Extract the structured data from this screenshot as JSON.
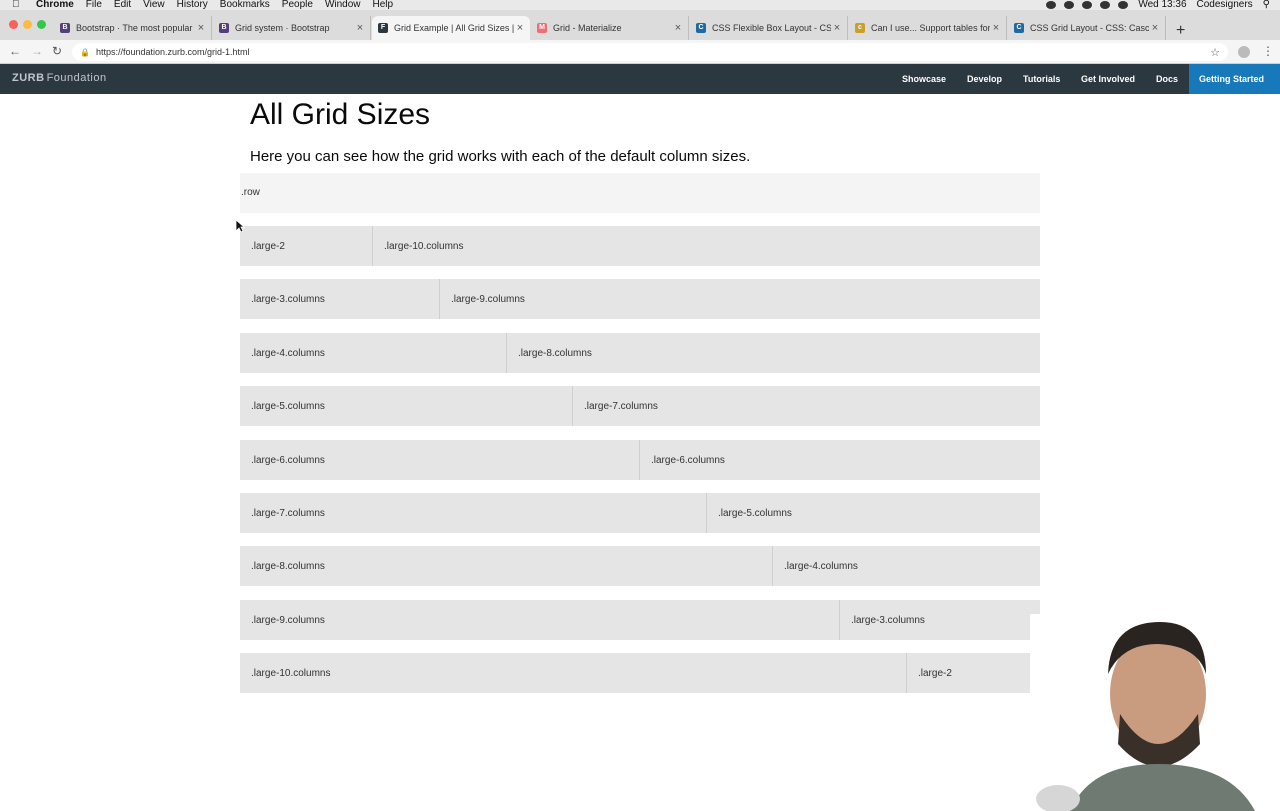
{
  "menubar": {
    "app": "Chrome",
    "items": [
      "File",
      "Edit",
      "View",
      "History",
      "Bookmarks",
      "People",
      "Window",
      "Help"
    ],
    "clock": "Wed 13:36",
    "user": "Codesigners"
  },
  "tabs": [
    {
      "title": "Bootstrap · The most popular H",
      "favicon": "B",
      "color": "#563d7c"
    },
    {
      "title": "Grid system · Bootstrap",
      "favicon": "B",
      "color": "#563d7c"
    },
    {
      "title": "Grid Example | All Grid Sizes | F",
      "favicon": "F",
      "color": "#2c3840"
    },
    {
      "title": "Grid - Materialize",
      "favicon": "M",
      "color": "#ee6e73"
    },
    {
      "title": "CSS Flexible Box Layout - CSS",
      "favicon": "C",
      "color": "#1f6aa5"
    },
    {
      "title": "Can I use... Support tables for",
      "favicon": "c",
      "color": "#c8a02c"
    },
    {
      "title": "CSS Grid Layout - CSS: Cascad",
      "favicon": "C",
      "color": "#1f6aa5"
    }
  ],
  "address": {
    "url": "https://foundation.zurb.com/grid-1.html"
  },
  "topbar": {
    "logo_zurb": "ZURB",
    "logo_foundation": "Foundation",
    "nav": [
      "Showcase",
      "Develop",
      "Tutorials",
      "Get Involved",
      "Docs"
    ],
    "cta": "Getting Started"
  },
  "page": {
    "title": "All Grid Sizes",
    "lead": "Here you can see how the grid works with each of the default column sizes.",
    "row_label": ".row",
    "rows": [
      {
        "left": ".large-2",
        "right": ".large-10.columns",
        "left_fraction": 0.1667
      },
      {
        "left": ".large-3.columns",
        "right": ".large-9.columns",
        "left_fraction": 0.25
      },
      {
        "left": ".large-4.columns",
        "right": ".large-8.columns",
        "left_fraction": 0.3333
      },
      {
        "left": ".large-5.columns",
        "right": ".large-7.columns",
        "left_fraction": 0.4167
      },
      {
        "left": ".large-6.columns",
        "right": ".large-6.columns",
        "left_fraction": 0.5
      },
      {
        "left": ".large-7.columns",
        "right": ".large-5.columns",
        "left_fraction": 0.5833
      },
      {
        "left": ".large-8.columns",
        "right": ".large-4.columns",
        "left_fraction": 0.6667
      },
      {
        "left": ".large-9.columns",
        "right": ".large-3.columns",
        "left_fraction": 0.75
      },
      {
        "left": ".large-10.columns",
        "right": ".large-2",
        "left_fraction": 0.8333
      }
    ]
  }
}
